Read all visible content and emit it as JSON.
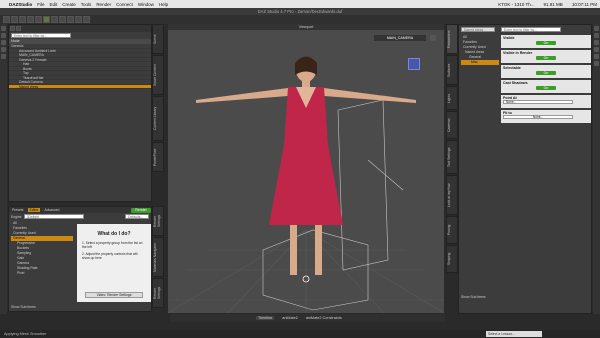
{
  "macos": {
    "apple": "",
    "app": "DAZStudio",
    "menus": [
      "File",
      "Edit",
      "Create",
      "Tools",
      "Render",
      "Connect",
      "Window",
      "Help"
    ],
    "status_items": [
      "KTOK - 1310 Th...",
      "91.91 MB",
      "10:07:11 PM"
    ]
  },
  "window": {
    "title": "DAZ Studio 4.7 Pro - Zamon/DecEdwards.duf"
  },
  "scene": {
    "filter_placeholder": "Enter text to filter by...",
    "header": "Node",
    "items": [
      "Genesis",
      "Advanced Ambient Light",
      "MAIN_CAMERA",
      "Genesis 2 Female",
      "Hair",
      "Boots",
      "Top",
      "Teardrop/Hair",
      "Default Camera",
      "Naned dress"
    ]
  },
  "render": {
    "tabs": [
      "Presets",
      "Editor",
      "Advanced"
    ],
    "render_button": "Render",
    "engine_label": "Engine",
    "engine_value": "3Delight",
    "settings_button": "Defaults...",
    "tree": [
      "All",
      "Favorites",
      "Currently Used",
      "General",
      "Progressive",
      "Buckets",
      "Sampling",
      "Gain",
      "Gamma",
      "Shading Rate",
      "Pixel"
    ],
    "help_title": "What do I do?",
    "help_steps": [
      "1. Select a property group from the list on the left",
      "2. Adjust the property controls that will show up here"
    ],
    "help_button": "Video: Render Settings",
    "show_sub": "Show Sub Items"
  },
  "viewport": {
    "tab": "Viewport",
    "camera": "MAIN_CAMERA",
    "vtabs_left": [
      "Scene",
      "Smart Content",
      "Content Library",
      "PowerPose"
    ],
    "vtabs_left_lower": [
      "Render Settings",
      "Materials Navigator",
      "Render Settings"
    ]
  },
  "params": {
    "node": "Naned dress",
    "filter_placeholder": "Enter text to filter by...",
    "tree": [
      "All",
      "Favorites",
      "Currently Used",
      "Naned dress",
      "General",
      "Misc"
    ],
    "props": [
      {
        "label": "Visible",
        "value": "On"
      },
      {
        "label": "Visible in Render",
        "value": "On"
      },
      {
        "label": "Selectable",
        "value": "On"
      },
      {
        "label": "Cast Shadows",
        "value": "On"
      },
      {
        "label": "Point At",
        "value": "None..."
      },
      {
        "label": "Fit to",
        "value": "None..."
      }
    ],
    "vtabs": [
      "Parameters",
      "Surfaces",
      "Lights",
      "Cameras",
      "Tool Settings",
      "Look at my Hair",
      "Posing",
      "Shaping"
    ],
    "show_sub": "Show Sub Items"
  },
  "timeline": {
    "tabs": [
      "Timeline",
      "aniMate2",
      "aniMate2 Constraints"
    ]
  },
  "statusbar": {
    "left": "Applying Mesh Smoother",
    "lesson": "Select a Lesson..."
  }
}
